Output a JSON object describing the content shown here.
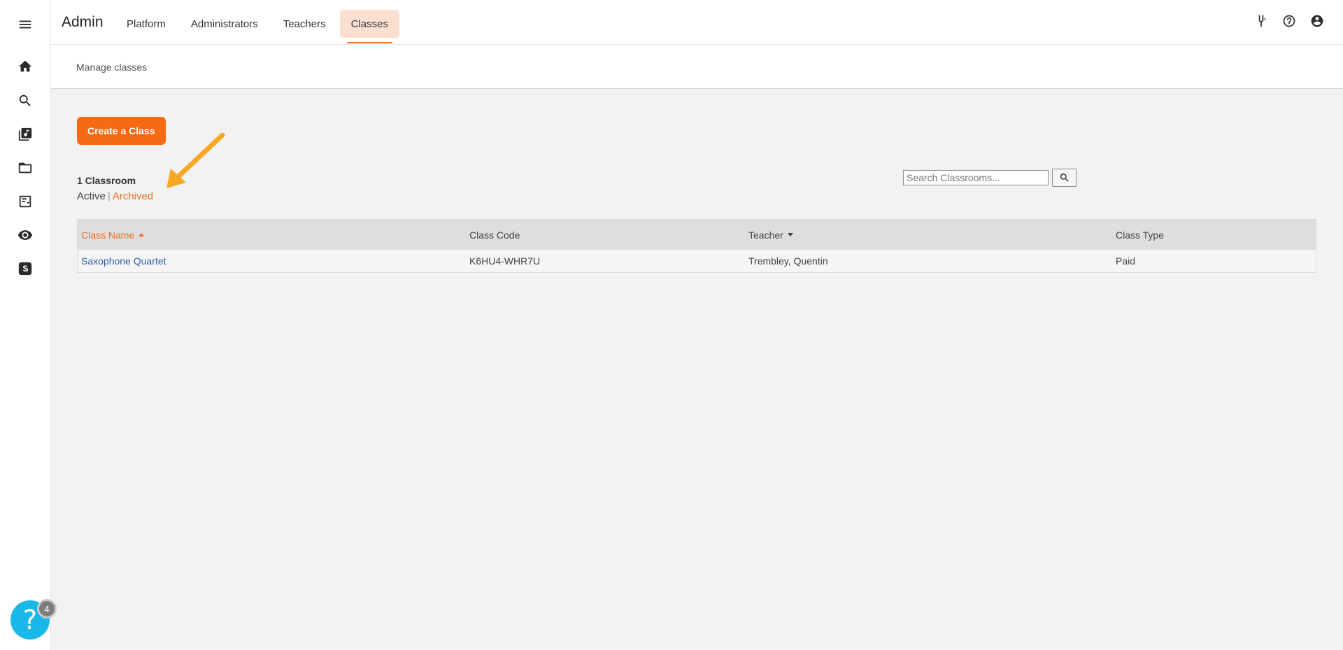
{
  "header": {
    "app_title": "Admin",
    "nav": [
      {
        "label": "Platform"
      },
      {
        "label": "Administrators"
      },
      {
        "label": "Teachers"
      },
      {
        "label": "Classes",
        "active": true
      }
    ],
    "icons": [
      "tuning-fork-icon",
      "help-circle-icon",
      "account-icon"
    ]
  },
  "sidebar": {
    "icons": [
      "menu-icon",
      "home-icon",
      "search-icon",
      "music-library-icon",
      "folder-icon",
      "assignment-icon",
      "eye-icon",
      "smartmusic-logo-icon"
    ]
  },
  "subheader": {
    "title": "Manage classes"
  },
  "main": {
    "create_button": "Create a Class",
    "count_label": "1 Classroom",
    "filters": {
      "active": "Active",
      "separator": "|",
      "archived": "Archived"
    },
    "search": {
      "placeholder": "Search Classrooms...",
      "value": ""
    },
    "table": {
      "columns": [
        "Class Name",
        "Class Code",
        "Teacher",
        "Class Type"
      ],
      "rows": [
        {
          "name": "Saxophone Quartet",
          "code": "K6HU4-WHR7U",
          "teacher": "Trembley, Quentin",
          "type": "Paid"
        }
      ]
    }
  },
  "help": {
    "icon": "?",
    "badge": "4"
  },
  "colors": {
    "accent": "#f26d21",
    "button": "#f56a12",
    "link": "#2f5fa8",
    "help": "#19b8e8",
    "arrow": "#f7a823"
  }
}
